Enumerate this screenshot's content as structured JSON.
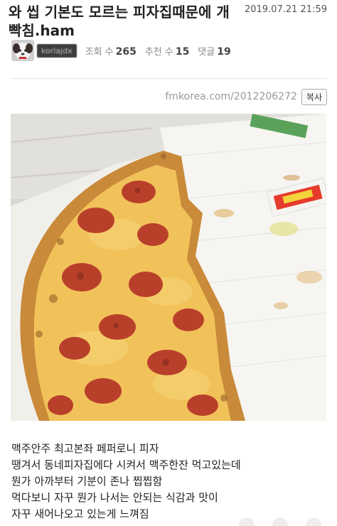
{
  "post": {
    "title_line1": "와 씹 기본도 모르는 피자집때문에 개",
    "title_line2": "빡침.ham",
    "date": "2019.07.21 21:59",
    "author": "korlajdx",
    "stats": {
      "views_label": "조회 수",
      "views": "265",
      "recommend_label": "추천 수",
      "recommend": "15",
      "comments_label": "댓글",
      "comments": "19"
    },
    "url": "fmkorea.com/2012206272",
    "copy_label": "복사"
  },
  "content": {
    "lines": [
      "맥주안주 최고본좌 페퍼로니 피자",
      "땡겨서 동네피자집에다 시켜서 맥주한잔 먹고있는데",
      "뭔가 아까부터 기분이 존나 찝찝함",
      "먹다보니 자꾸 뭔가 나서는 안되는 식감과 맛이",
      "자꾸 새어나오고 있는게 느껴짐"
    ]
  },
  "colors": {
    "pizza_crust": "#c98a3a",
    "cheese": "#f2c25a",
    "pepperoni": "#b8402a",
    "box": "#f3f1ec"
  }
}
